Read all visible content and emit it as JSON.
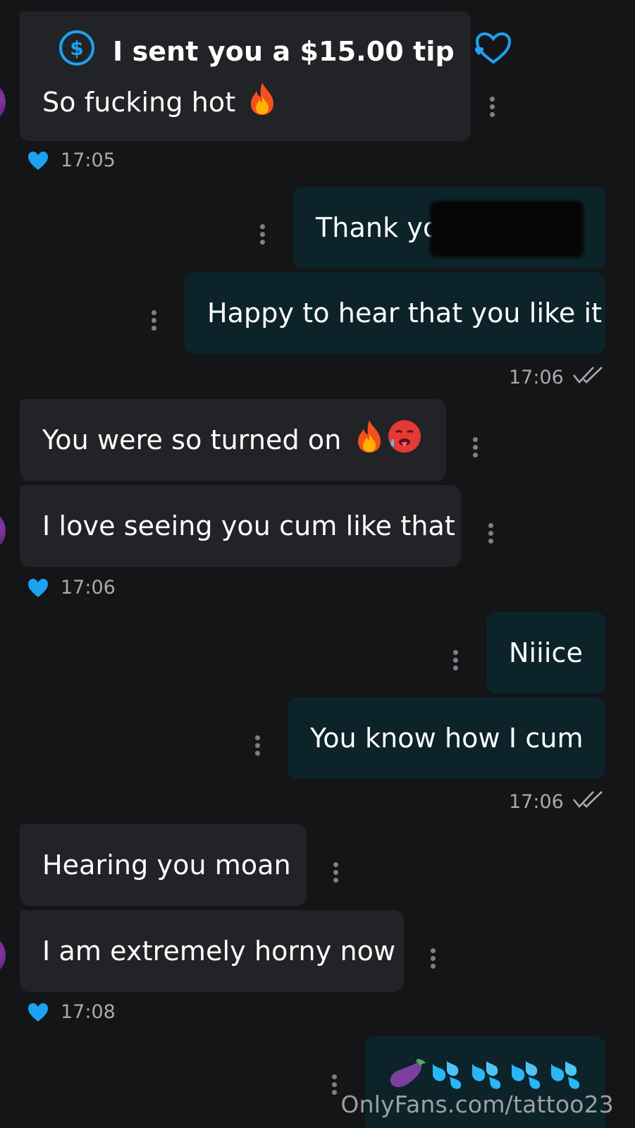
{
  "messages": {
    "m1": {
      "tip_text": "I sent you a $15.00 tip",
      "text": "So fucking hot"
    },
    "m1_time": "17:05",
    "m2": {
      "text": "Thank you"
    },
    "m3": {
      "text": "Happy to hear that you like it"
    },
    "m3_time": "17:06",
    "m4": {
      "text": "You were so turned on"
    },
    "m5": {
      "text": "I love seeing you cum like that"
    },
    "m5_time": "17:06",
    "m6": {
      "text": "Niiice"
    },
    "m7": {
      "text": "You know how I cum"
    },
    "m7_time": "17:06",
    "m8": {
      "text": "Hearing you moan"
    },
    "m9": {
      "text": "I am extremely horny now"
    },
    "m9_time": "17:08",
    "m10": {
      "emojis": [
        "eggplant",
        "sweat-droplets",
        "sweat-droplets",
        "sweat-droplets",
        "sweat-droplets"
      ]
    }
  },
  "watermark": "OnlyFans.com/tattoo23",
  "colors": {
    "background": "#141517",
    "incoming_bubble": "#212326",
    "outgoing_bubble": "#0c2329",
    "accent": "#1da1f2"
  }
}
